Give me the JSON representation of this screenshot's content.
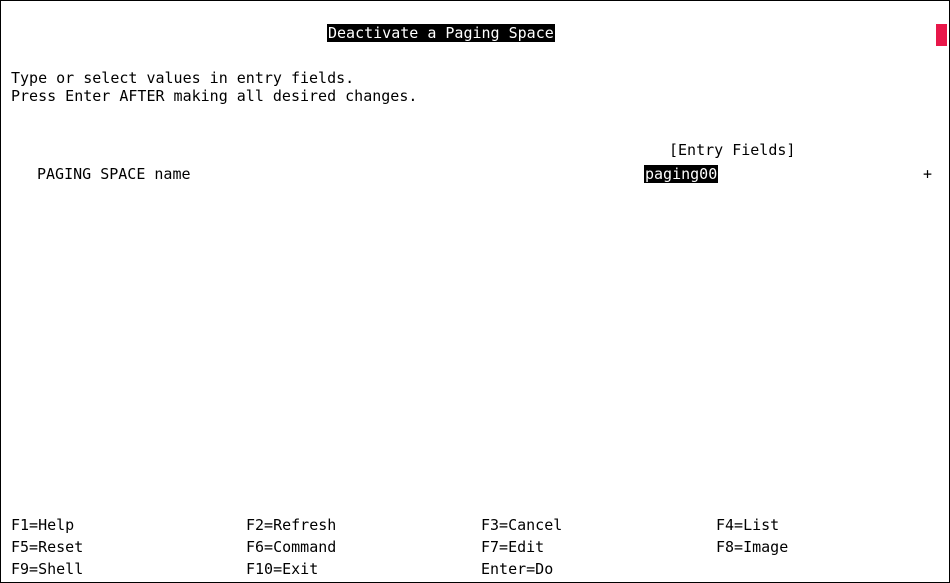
{
  "screen": {
    "title": "Deactivate a Paging Space",
    "instructions": [
      "Type or select values in entry fields.",
      "Press Enter AFTER making all desired changes."
    ],
    "entry_fields_header": "[Entry Fields]",
    "fields": [
      {
        "label": "PAGING SPACE name",
        "value": "paging00",
        "list_indicator": "+"
      }
    ]
  },
  "function_keys": [
    [
      "F1=Help",
      "F2=Refresh",
      "F3=Cancel",
      "F4=List"
    ],
    [
      "F5=Reset",
      "F6=Command",
      "F7=Edit",
      "F8=Image"
    ],
    [
      "F9=Shell",
      "F10=Exit",
      "Enter=Do",
      ""
    ]
  ],
  "colors": {
    "background": "#ffffff",
    "text": "#000000",
    "highlight_bg": "#000000",
    "highlight_text": "#ffffff",
    "cursor": "#e8174a"
  }
}
